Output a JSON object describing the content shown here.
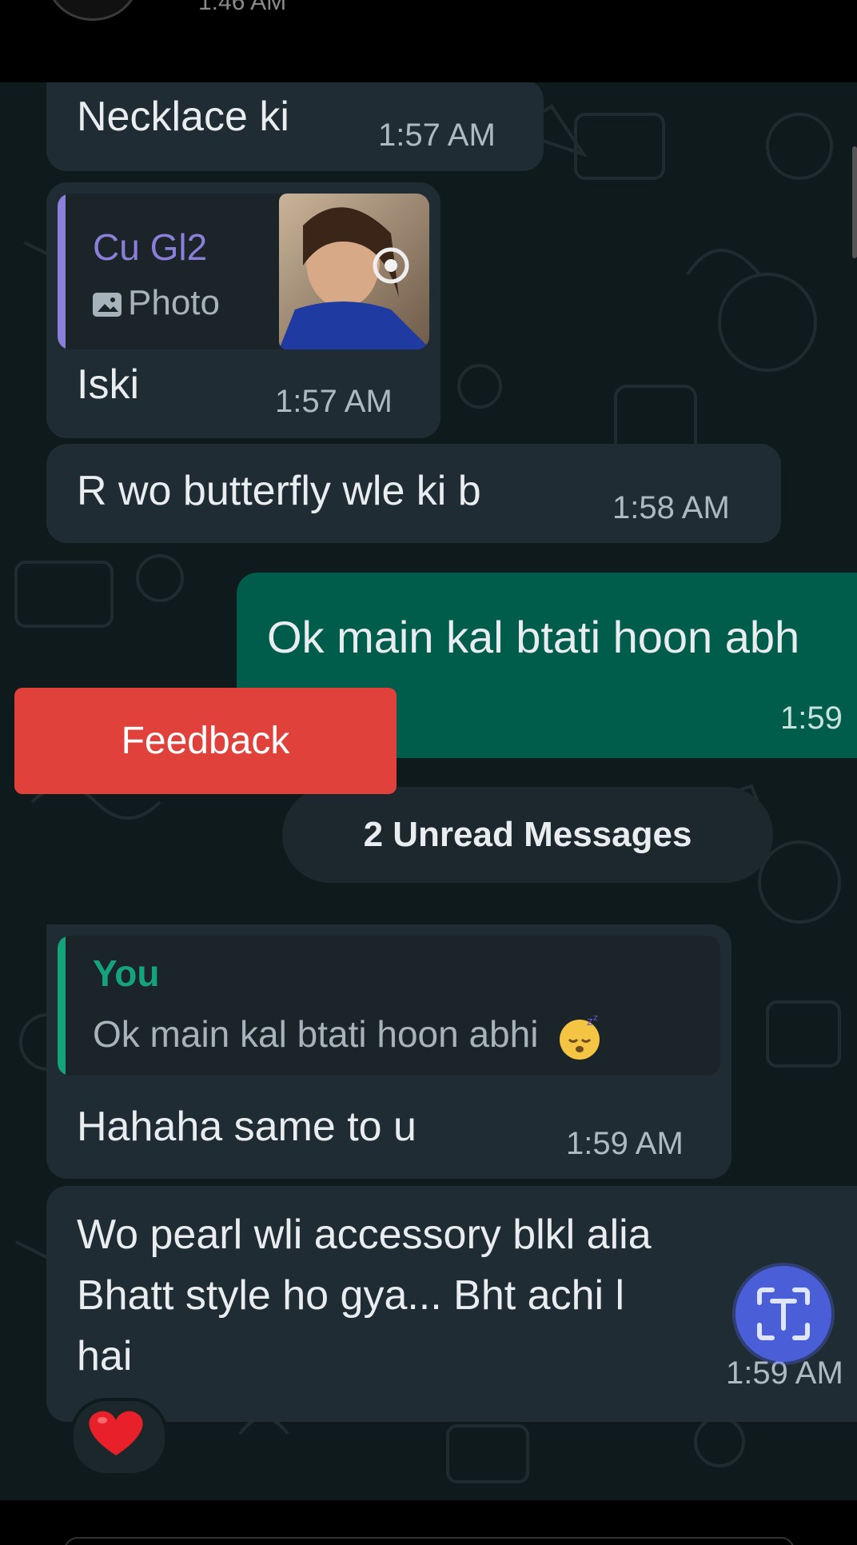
{
  "status": {
    "time": "1:46 AM"
  },
  "messages": {
    "m1": {
      "text": "Necklace ki",
      "time": "1:57 AM"
    },
    "m2": {
      "quote_sender": "Cu Gl2",
      "quote_type": "Photo",
      "text": "Iski",
      "time": "1:57 AM"
    },
    "m3": {
      "text": "R wo butterfly wle ki b",
      "time": "1:58 AM"
    },
    "m4": {
      "text": "Ok main kal btati hoon abh",
      "time": "1:59"
    },
    "m5": {
      "quote_sender": "You",
      "quote_text": "Ok main kal btati hoon abhi",
      "text": "Hahaha same to u",
      "time": "1:59 AM"
    },
    "m6": {
      "line1": "Wo pearl wli accessory blkl alia",
      "line2": "Bhatt style ho gya... Bht achi l",
      "line3": "hai",
      "time": "1:59 AM",
      "reaction": "heart"
    }
  },
  "unread": {
    "label": "2 Unread Messages"
  },
  "feedback": {
    "label": "Feedback"
  },
  "fab": {
    "icon": "text-scan-icon"
  },
  "colors": {
    "chat_bg": "#0f1a1d",
    "incoming": "#202c33",
    "outgoing": "#005c4b",
    "quote_purple": "#8b7fd9",
    "quote_green": "#15a37a",
    "feedback": "#e0413b"
  }
}
